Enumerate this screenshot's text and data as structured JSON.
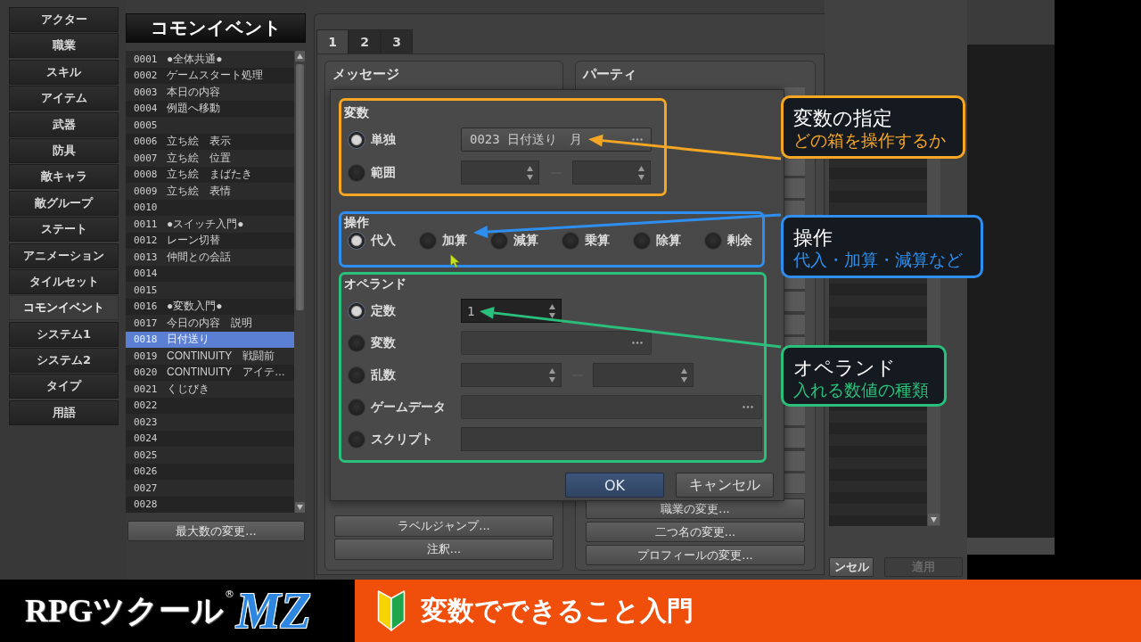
{
  "sidebar": {
    "items": [
      {
        "label": "アクター",
        "selected": false
      },
      {
        "label": "職業",
        "selected": false
      },
      {
        "label": "スキル",
        "selected": false
      },
      {
        "label": "アイテム",
        "selected": false
      },
      {
        "label": "武器",
        "selected": false
      },
      {
        "label": "防具",
        "selected": false
      },
      {
        "label": "敵キャラ",
        "selected": false
      },
      {
        "label": "敵グループ",
        "selected": false
      },
      {
        "label": "ステート",
        "selected": false
      },
      {
        "label": "アニメーション",
        "selected": false
      },
      {
        "label": "タイルセット",
        "selected": false
      },
      {
        "label": "コモンイベント",
        "selected": true
      },
      {
        "label": "システム1",
        "selected": false
      },
      {
        "label": "システム2",
        "selected": false
      },
      {
        "label": "タイプ",
        "selected": false
      },
      {
        "label": "用語",
        "selected": false
      }
    ]
  },
  "event_list": {
    "title": "コモンイベント",
    "rows": [
      {
        "id": "0001",
        "name": "●全体共通●",
        "selected": false
      },
      {
        "id": "0002",
        "name": "ゲームスタート処理",
        "selected": false
      },
      {
        "id": "0003",
        "name": "本日の内容",
        "selected": false
      },
      {
        "id": "0004",
        "name": "例題へ移動",
        "selected": false
      },
      {
        "id": "0005",
        "selected": false
      },
      {
        "id": "0006",
        "name": "立ち絵　表示",
        "selected": false
      },
      {
        "id": "0007",
        "name": "立ち絵　位置",
        "selected": false
      },
      {
        "id": "0008",
        "name": "立ち絵　まばたき",
        "selected": false
      },
      {
        "id": "0009",
        "name": "立ち絵　表情",
        "selected": false
      },
      {
        "id": "0010",
        "selected": false
      },
      {
        "id": "0011",
        "name": "●スイッチ入門●",
        "selected": false
      },
      {
        "id": "0012",
        "name": "レーン切替",
        "selected": false
      },
      {
        "id": "0013",
        "name": "仲間との会話",
        "selected": false
      },
      {
        "id": "0014",
        "selected": false
      },
      {
        "id": "0015",
        "selected": false
      },
      {
        "id": "0016",
        "name": "●変数入門●",
        "selected": false
      },
      {
        "id": "0017",
        "name": "今日の内容　説明",
        "selected": false
      },
      {
        "id": "0018",
        "name": "日付送り",
        "selected": true
      },
      {
        "id": "0019",
        "name": "CONTINUITY　戦闘前",
        "selected": false
      },
      {
        "id": "0020",
        "name": "CONTINUITY　アイテ…",
        "selected": false
      },
      {
        "id": "0021",
        "name": "くじびき",
        "selected": false
      },
      {
        "id": "0022",
        "selected": false
      },
      {
        "id": "0023",
        "selected": false
      },
      {
        "id": "0024",
        "selected": false
      },
      {
        "id": "0025",
        "selected": false
      },
      {
        "id": "0026",
        "selected": false
      },
      {
        "id": "0027",
        "selected": false
      },
      {
        "id": "0028",
        "selected": false
      }
    ],
    "button": "最大数の変更..."
  },
  "command_window": {
    "tabs": [
      {
        "label": "1",
        "selected": true
      },
      {
        "label": "2",
        "selected": false
      },
      {
        "label": "3",
        "selected": false
      }
    ],
    "groups": [
      {
        "title": "メッセージ",
        "buttons": [
          "ラベルジャンプ...",
          "注釈..."
        ]
      },
      {
        "title": "パーティ",
        "buttons": [
          "職業の変更...",
          "二つ名の変更...",
          "プロフィールの変更..."
        ]
      }
    ]
  },
  "editor_buttons": [
    {
      "label": "ンセル",
      "disabled": false
    },
    {
      "label": "適用",
      "disabled": true
    }
  ],
  "dialog": {
    "groups": [
      {
        "title": "変数",
        "kind": "stacked",
        "options": [
          {
            "label": "単独",
            "selected": true,
            "kind": "picker",
            "value": "0023 日付送り　月"
          },
          {
            "label": "範囲",
            "selected": false,
            "kind": "range"
          }
        ]
      },
      {
        "title": "操作",
        "kind": "inline",
        "options": [
          {
            "label": "代入",
            "selected": true
          },
          {
            "label": "加算",
            "selected": false
          },
          {
            "label": "減算",
            "selected": false
          },
          {
            "label": "乗算",
            "selected": false
          },
          {
            "label": "除算",
            "selected": false
          },
          {
            "label": "剰余",
            "selected": false
          }
        ]
      },
      {
        "title": "オペランド",
        "kind": "stacked",
        "options": [
          {
            "label": "定数",
            "selected": true,
            "kind": "spin",
            "value": "1"
          },
          {
            "label": "変数",
            "selected": false,
            "kind": "picker"
          },
          {
            "label": "乱数",
            "selected": false,
            "kind": "range"
          },
          {
            "label": "ゲームデータ",
            "selected": false,
            "kind": "long_picker"
          },
          {
            "label": "スクリプト",
            "selected": false,
            "kind": "text"
          }
        ]
      }
    ],
    "buttons": [
      {
        "label": "OK",
        "kind": "default"
      },
      {
        "label": "キャンセル",
        "kind": "normal"
      }
    ]
  },
  "callouts": [
    {
      "title": "変数の指定",
      "subtitle": "どの箱を操作するか",
      "color": "#f5a623"
    },
    {
      "title": "操作",
      "subtitle": "代入・加算・減算など",
      "color": "#2e8ff0"
    },
    {
      "title": "オペランド",
      "subtitle": "入れる数値の種類",
      "color": "#2bbf7c"
    }
  ],
  "banner": {
    "logo": {
      "text": "RPGツクール",
      "mark": "®",
      "badge": "MZ"
    },
    "title": "変数でできること入門"
  }
}
